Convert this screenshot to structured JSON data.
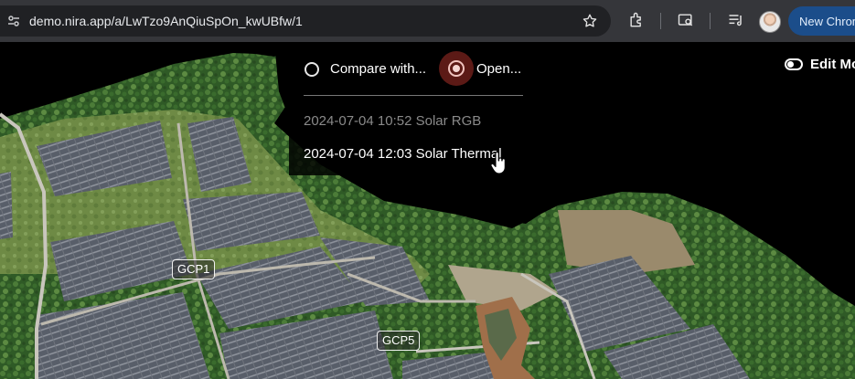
{
  "browser": {
    "url": "demo.nira.app/a/LwTzo9AnQiuSpOn_kwUBfw/1",
    "new_chrome_label": "New Chrome",
    "icons": [
      "site-info-icon",
      "bookmark-star-icon",
      "extensions-icon",
      "search-tab-icon",
      "reading-list-icon",
      "profile-avatar"
    ]
  },
  "dropdown": {
    "compare_label": "Compare with...",
    "open_label": "Open...",
    "items": [
      {
        "label": "2024-07-04 10:52 Solar RGB",
        "state": "current"
      },
      {
        "label": "2024-07-04 12:03 Solar Thermal",
        "state": "hover"
      }
    ]
  },
  "edit_mode_label": "Edit Mode",
  "markers": [
    {
      "label": "GCP1"
    },
    {
      "label": "GCP5"
    }
  ],
  "colors": {
    "accent_halo": "#5c1a16",
    "muted_text": "#8a8a8a",
    "toolbar": "#35363a"
  }
}
